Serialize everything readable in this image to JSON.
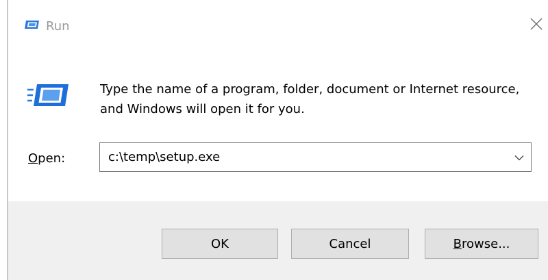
{
  "window": {
    "title": "Run"
  },
  "icons": {
    "title": "run-icon",
    "body": "run-icon",
    "close": "close-icon",
    "dropdown": "chevron-down-icon"
  },
  "dialog": {
    "message": "Type the name of a program, folder, document or Internet resource, and Windows will open it for you.",
    "open_label_mnemonic": "O",
    "open_label_rest": "pen:",
    "open_value": "c:\\temp\\setup.exe"
  },
  "buttons": {
    "ok_label": "OK",
    "cancel_label": "Cancel",
    "browse_mnemonic": "B",
    "browse_rest": "rowse..."
  },
  "colors": {
    "accent": "#1e6fd9",
    "footer_bg": "#f0f0f0",
    "button_bg": "#e1e1e1",
    "title_text": "#9a9a9a"
  }
}
